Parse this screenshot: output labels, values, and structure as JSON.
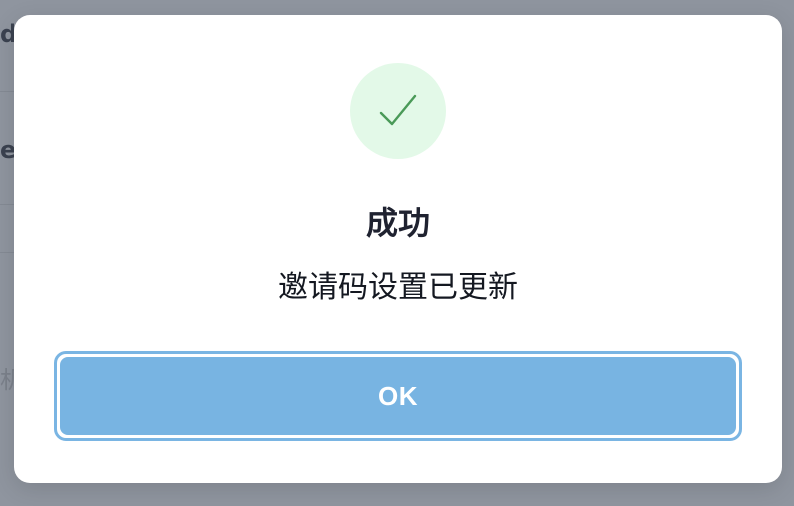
{
  "background": {
    "fragment_1": "d",
    "fragment_2": "e",
    "fragment_3": "机"
  },
  "dialog": {
    "icon": "checkmark-icon",
    "title": "成功",
    "message": "邀请码设置已更新",
    "ok_label": "OK"
  },
  "colors": {
    "success_bg": "#e3f9e8",
    "success_check": "#4a9a58",
    "primary_button": "#78b4e2",
    "focus_ring": "#7ab5e3"
  }
}
